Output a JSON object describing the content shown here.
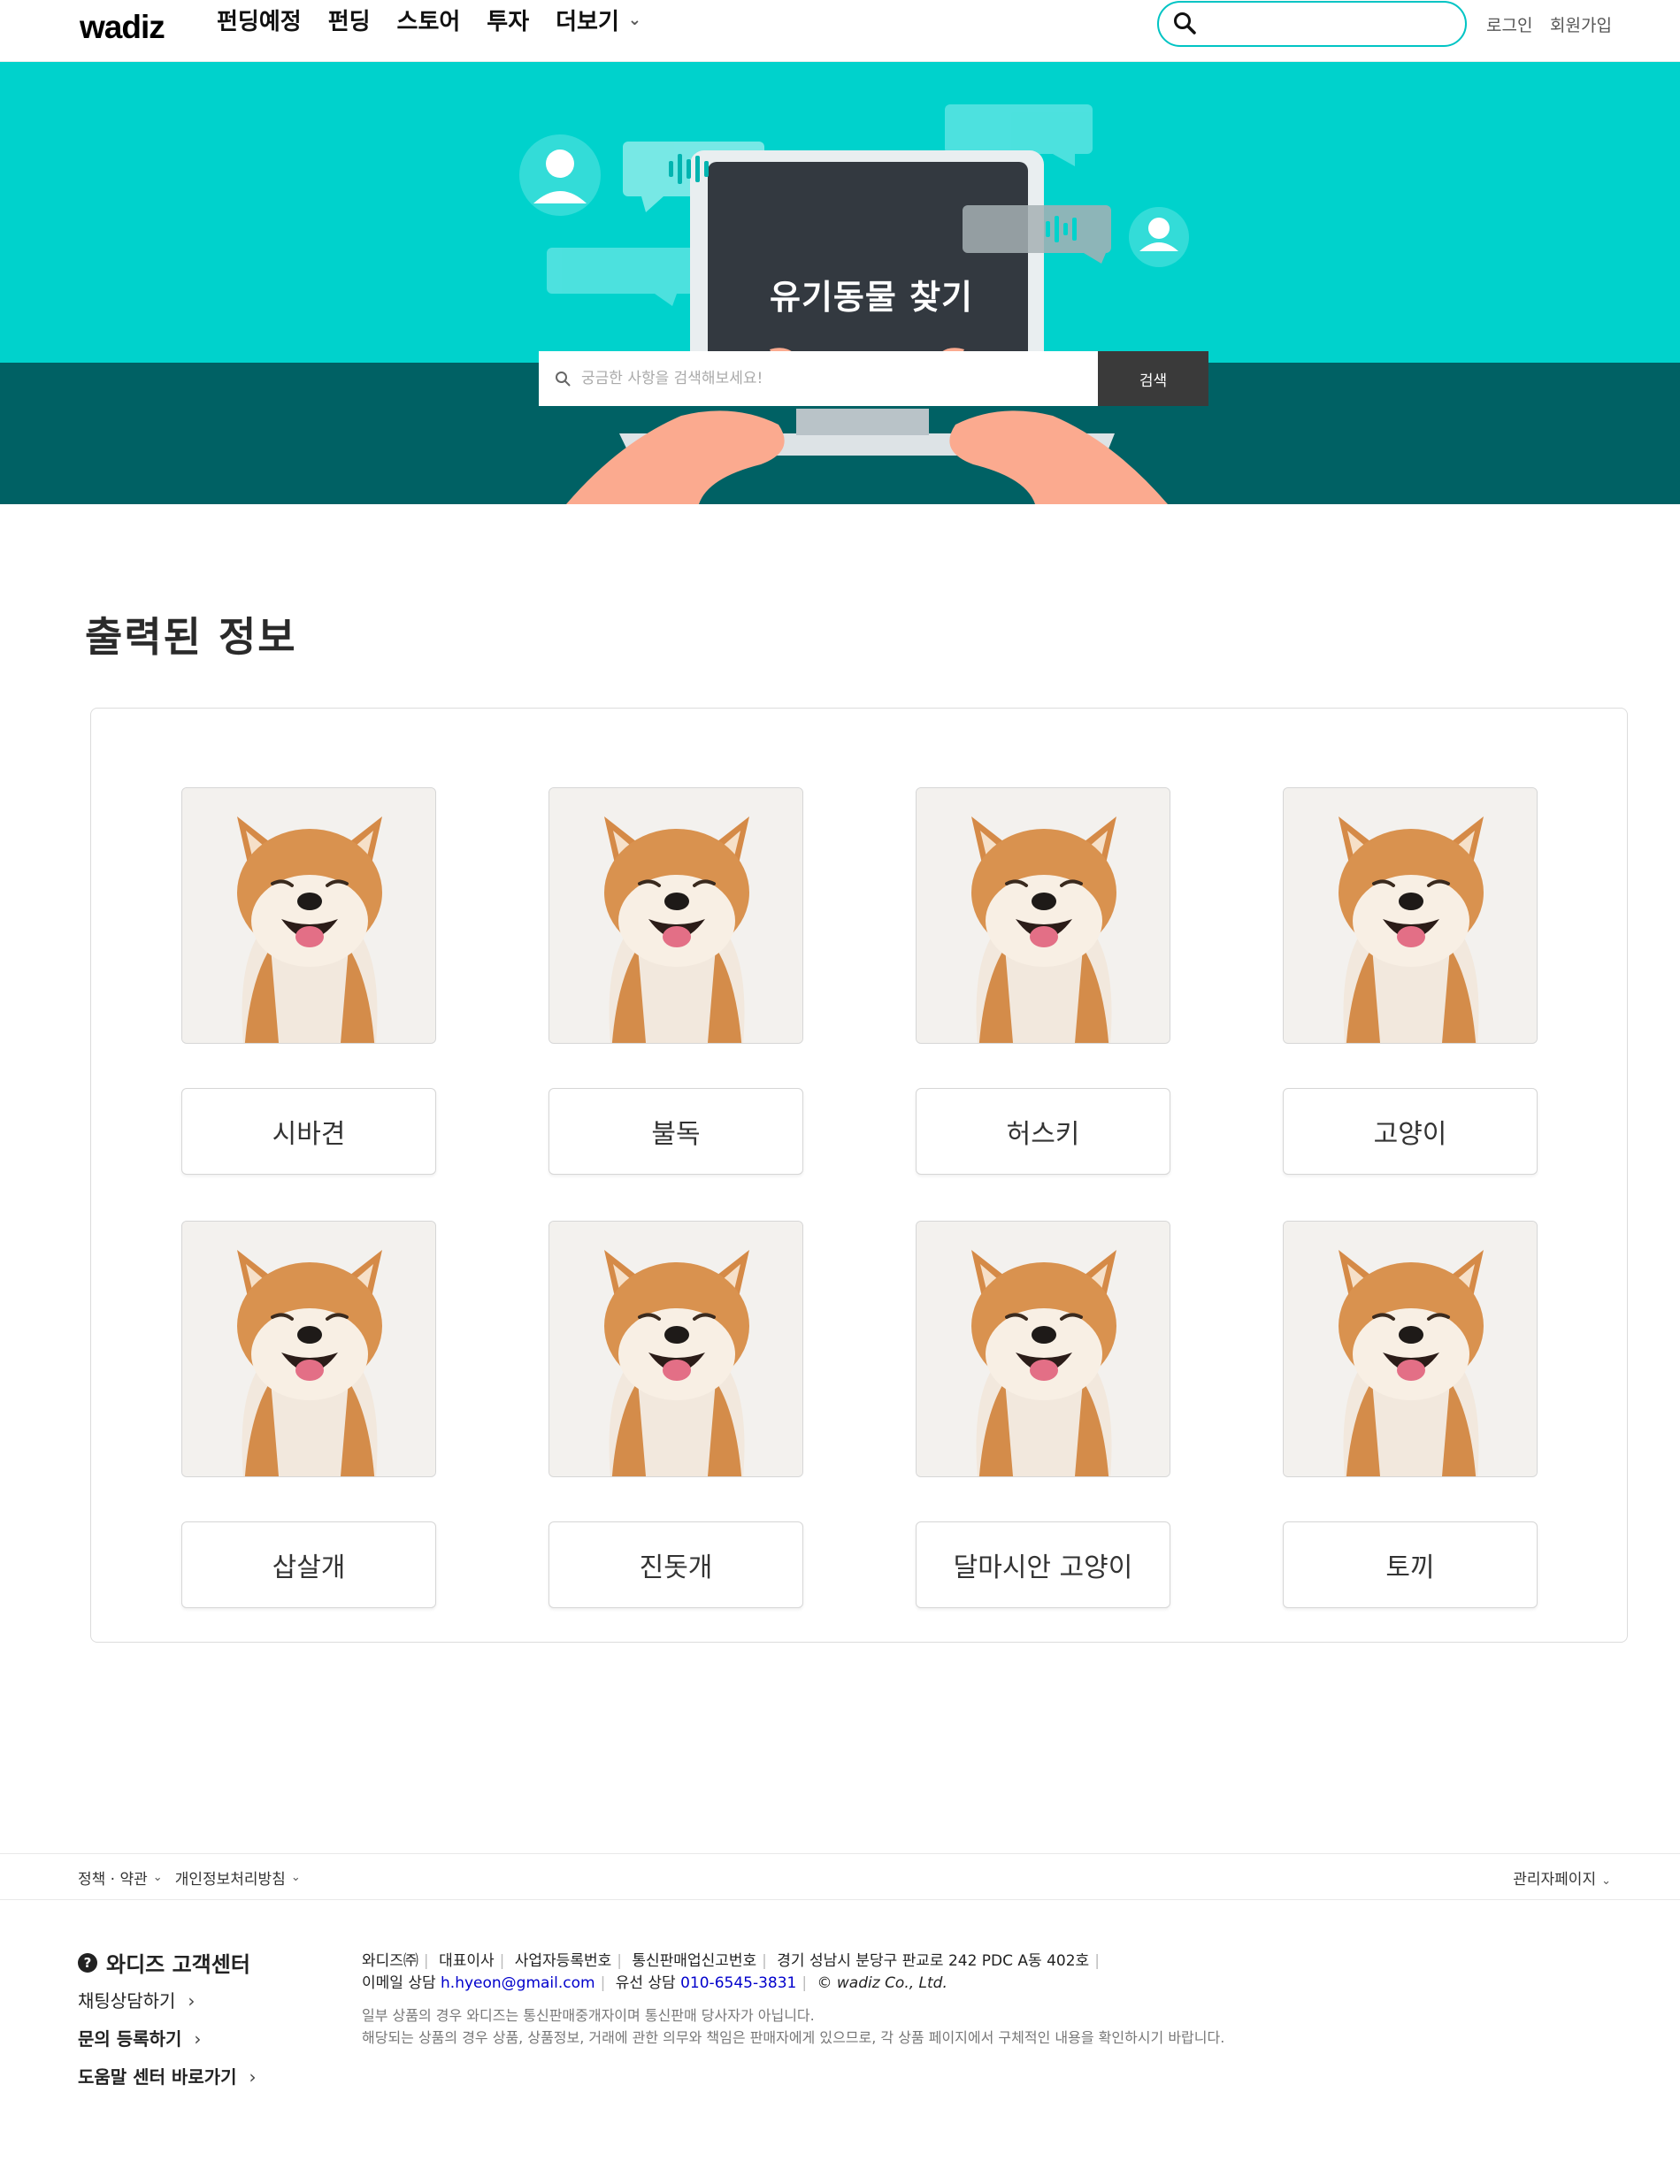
{
  "header": {
    "logo": "wadiz",
    "nav": [
      "펀딩예정",
      "펀딩",
      "스토어",
      "투자",
      "더보기"
    ],
    "search_placeholder": "",
    "login": "로그인",
    "signup": "회원가입"
  },
  "banner": {
    "title": "유기동물 찾기",
    "search_placeholder": "궁금한 사항을 검색해보세요!",
    "search_button": "검색",
    "colors": {
      "top": "#00d2cc",
      "bottom": "#006164"
    }
  },
  "section": {
    "title": "출력된 정보",
    "cards": [
      {
        "label": "시바견",
        "image": "shiba-dog-photo"
      },
      {
        "label": "불독",
        "image": "shiba-dog-photo"
      },
      {
        "label": "허스키",
        "image": "shiba-dog-photo"
      },
      {
        "label": "고양이",
        "image": "shiba-dog-photo"
      },
      {
        "label": "삽살개",
        "image": "shiba-dog-photo"
      },
      {
        "label": "진돗개",
        "image": "shiba-dog-photo"
      },
      {
        "label": "달마시안 고양이",
        "image": "shiba-dog-photo"
      },
      {
        "label": "토끼",
        "image": "shiba-dog-photo"
      }
    ]
  },
  "footer": {
    "policy": "정책 · 약관",
    "privacy": "개인정보처리방침",
    "admin": "관리자페이지",
    "cs_title": "와디즈 고객센터",
    "cs_links": [
      "채팅상담하기",
      "문의 등록하기",
      "도움말 센터 바로가기"
    ],
    "company": "와디즈㈜",
    "ceo": "대표이사",
    "biz_no": "사업자등록번호",
    "mail_order": "통신판매업신고번호",
    "address": "경기 성남시 분당구 판교로 242 PDC A동 402호",
    "email_label": "이메일 상담",
    "email": "h.hyeon@gmail.com",
    "phone_label": "유선 상담",
    "phone": "010-6545-3831",
    "copyright": "© wadiz Co., Ltd.",
    "notice_1": "일부 상품의 경우 와디즈는 통신판매중개자이며 통신판매 당사자가 아닙니다.",
    "notice_2": "해당되는 상품의 경우 상품, 상품정보, 거래에 관한 의무와 책임은 판매자에게 있으므로, 각 상품 페이지에서 구체적인 내용을 확인하시기 바랍니다."
  }
}
